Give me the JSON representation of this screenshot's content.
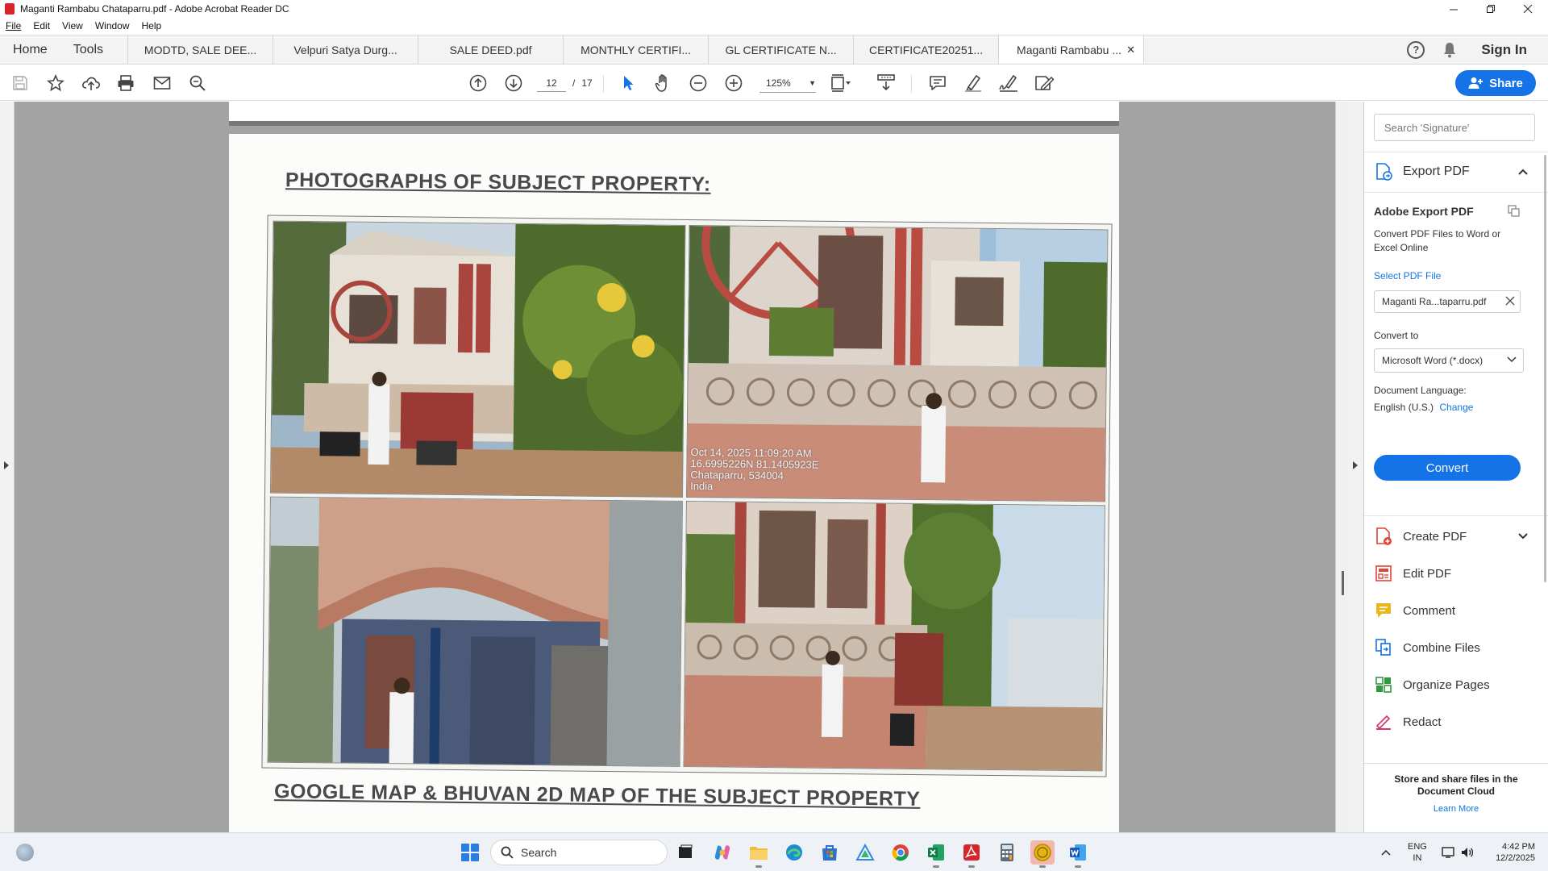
{
  "window": {
    "title": "Maganti Rambabu Chataparru.pdf - Adobe Acrobat Reader DC",
    "controls": [
      "minimize-icon",
      "restore-icon",
      "close-icon"
    ]
  },
  "menu": [
    "File",
    "Edit",
    "View",
    "Window",
    "Help"
  ],
  "tabs": {
    "home": "Home",
    "tools": "Tools",
    "documents": [
      {
        "label": "MODTD, SALE DEE..."
      },
      {
        "label": "Velpuri Satya Durg..."
      },
      {
        "label": "SALE DEED.pdf"
      },
      {
        "label": "MONTHLY CERTIFI..."
      },
      {
        "label": "GL CERTIFICATE N..."
      },
      {
        "label": "CERTIFICATE20251..."
      },
      {
        "label": "Maganti Rambabu ...",
        "active": true
      }
    ],
    "close_glyph": "✕",
    "help_glyph": "?",
    "sign_in": "Sign In"
  },
  "toolbar": {
    "current_page": "12",
    "separator": "/",
    "total_pages": "17",
    "zoom": "125%",
    "share_label": "Share",
    "icons": [
      "save-icon",
      "bookmark-star-icon",
      "upload-cloud-icon",
      "print-icon",
      "email-icon",
      "zoom-search-icon",
      "page-up-icon",
      "page-down-icon",
      "select-arrow-icon",
      "hand-icon",
      "zoom-out-icon",
      "zoom-in-icon",
      "fit-page-icon",
      "scroll-mode-icon",
      "comment-icon",
      "highlight-pen-icon",
      "sign-icon",
      "more-tools-icon"
    ]
  },
  "document": {
    "heading_photos": "PHOTOGRAPHS OF SUBJECT PROPERTY:",
    "heading_map": "GOOGLE MAP & BHUVAN 2D MAP OF THE SUBJECT PROPERTY",
    "photo_stamp": [
      "Oct 14, 2025 11:09:20 AM",
      "16.6995226N 81.1405923E",
      "Chataparru, 534004",
      "India"
    ]
  },
  "right_panel": {
    "search_placeholder": "Search 'Signature'",
    "export_section": "Export PDF",
    "export_title": "Adobe Export PDF",
    "export_desc": "Convert PDF Files to Word or Excel Online",
    "select_file": "Select PDF File",
    "file_name": "Maganti Ra...taparru.pdf",
    "convert_to_label": "Convert to",
    "convert_to_value": "Microsoft Word (*.docx)",
    "doc_lang_label": "Document Language:",
    "doc_lang_value": "English (U.S.)",
    "doc_lang_change": "Change",
    "convert_button": "Convert",
    "tools": [
      {
        "label": "Create PDF",
        "color": "#e0433a"
      },
      {
        "label": "Edit PDF",
        "color": "#e0433a"
      },
      {
        "label": "Comment",
        "color": "#e8b719"
      },
      {
        "label": "Combine Files",
        "color": "#1473e6"
      },
      {
        "label": "Organize Pages",
        "color": "#2e9a3e"
      },
      {
        "label": "Redact",
        "color": "#d9386c"
      }
    ],
    "cloud_title": "Store and share files in the Document Cloud",
    "cloud_link": "Learn More"
  },
  "taskbar": {
    "search_label": "Search",
    "lang_line1": "ENG",
    "lang_line2": "IN",
    "time": "4:42 PM",
    "date": "12/2/2025"
  }
}
